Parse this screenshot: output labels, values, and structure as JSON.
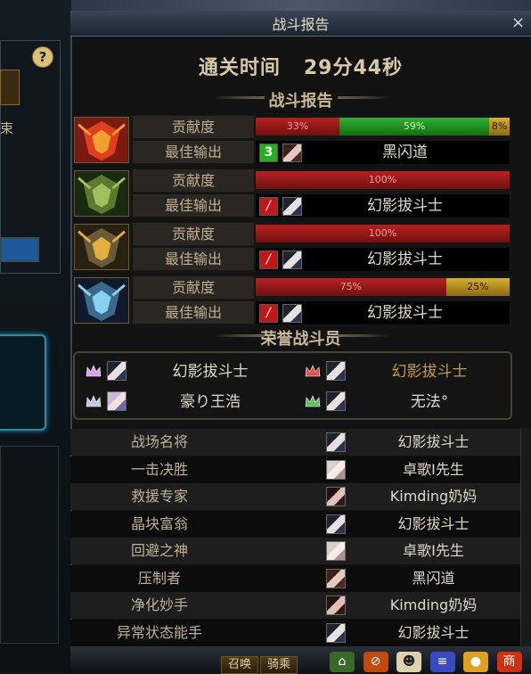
{
  "window": {
    "title": "战斗报告",
    "close_label": "×"
  },
  "clear_time": {
    "label": "通关时间",
    "value": "29分44秒"
  },
  "sections": {
    "battle_report": "战斗报告",
    "honor": "荣誉战斗员"
  },
  "row_labels": {
    "contribution": "贡献度",
    "best_output": "最佳输出"
  },
  "bosses": [
    {
      "icon": "red-armored-mask-icon",
      "contribution": [
        {
          "pct": 33,
          "label": "33%",
          "color": "red"
        },
        {
          "pct": 59,
          "label": "59%",
          "color": "green"
        },
        {
          "pct": 8,
          "label": "8%",
          "color": "gold"
        }
      ],
      "skill": "3",
      "skill_color": "green",
      "best_output": "黑闪道",
      "face": "brown"
    },
    {
      "icon": "green-horned-mask-icon",
      "contribution": [
        {
          "pct": 100,
          "label": "100%",
          "color": "red"
        }
      ],
      "skill": "/",
      "skill_color": "red",
      "best_output": "幻影拔斗士",
      "face": "dark-blue"
    },
    {
      "icon": "gold-horned-mask-icon",
      "contribution": [
        {
          "pct": 100,
          "label": "100%",
          "color": "red"
        }
      ],
      "skill": "/",
      "skill_color": "red",
      "best_output": "幻影拔斗士",
      "face": "dark-blue"
    },
    {
      "icon": "blue-horned-mask-icon",
      "contribution": [
        {
          "pct": 75,
          "label": "75%",
          "color": "red"
        },
        {
          "pct": 25,
          "label": "25%",
          "color": "gold"
        }
      ],
      "skill": "/",
      "skill_color": "red",
      "best_output": "幻影拔斗士",
      "face": "dark-blue"
    }
  ],
  "honor_members": [
    {
      "name": "幻影拔斗士",
      "crown": "gold-crown-icon",
      "highlight": false
    },
    {
      "name": "幻影拔斗士",
      "crown": "red-crown-icon",
      "highlight": true
    },
    {
      "name": "豪り王浩",
      "crown": "silver-crown-icon",
      "highlight": false
    },
    {
      "name": "无法°",
      "crown": "green-crown-icon",
      "highlight": false
    }
  ],
  "awards": [
    {
      "title": "战场名将",
      "player": "幻影拔斗士",
      "face": "dark-blue"
    },
    {
      "title": "一击决胜",
      "player": "卓歌I先生",
      "face": "pale"
    },
    {
      "title": "救援专家",
      "player": "Kimding奶妈",
      "face": "dark"
    },
    {
      "title": "晶块富翁",
      "player": "幻影拔斗士",
      "face": "dark-blue"
    },
    {
      "title": "回避之神",
      "player": "卓歌I先生",
      "face": "pale"
    },
    {
      "title": "压制者",
      "player": "黑闪道",
      "face": "brown"
    },
    {
      "title": "净化妙手",
      "player": "Kimding奶妈",
      "face": "dark"
    },
    {
      "title": "异常状态能手",
      "player": "幻影拔斗士",
      "face": "dark-blue"
    }
  ],
  "bottom_bar": {
    "btn1": "召唤",
    "btn2": "骑乘",
    "tools": [
      "home-icon",
      "no-entry-icon",
      "emote-face-icon",
      "menu-icon",
      "gold-coin-icon",
      "shop-icon"
    ],
    "shop_label": "商"
  },
  "left_panel": {
    "help_label": "?",
    "fragment_text": "束"
  }
}
